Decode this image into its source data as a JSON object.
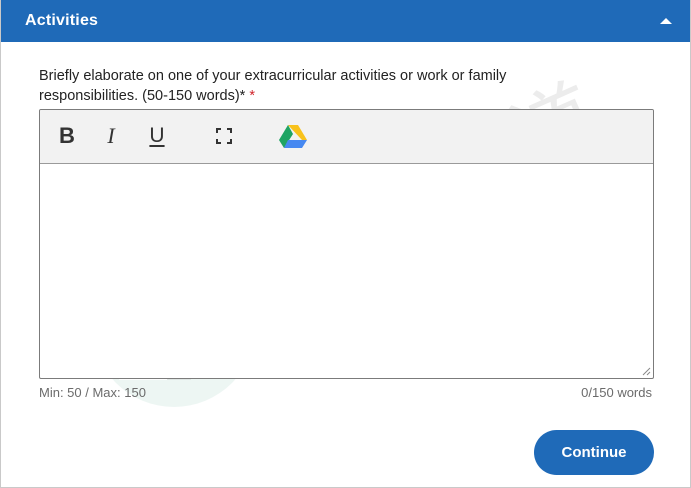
{
  "header": {
    "title": "Activities",
    "collapse_icon": "chevron-up-icon"
  },
  "question": {
    "text": "Briefly elaborate on one of your extracurricular activities or work or family responsibilities. (50-150 words)*",
    "required_marker": "*"
  },
  "toolbar": {
    "bold_label": "B",
    "italic_label": "I",
    "underline_label": "U",
    "fullscreen_icon": "fullscreen-icon",
    "drive_icon": "google-drive-icon"
  },
  "editor": {
    "value": ""
  },
  "footer": {
    "limits": "Min: 50 / Max: 150",
    "word_count": "0/150 words"
  },
  "actions": {
    "continue_label": "Continue"
  },
  "watermark": {
    "text": "棕榈大道"
  },
  "colors": {
    "brand_blue": "#1f6ab8",
    "required_red": "#d0242b"
  }
}
